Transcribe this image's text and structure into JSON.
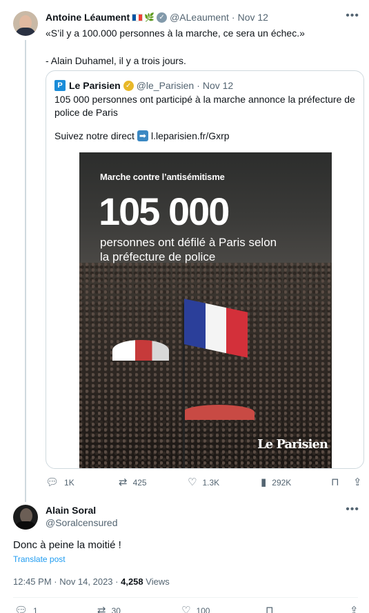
{
  "tweet1": {
    "author": "Antoine Léaument",
    "handle": "@ALeaument",
    "time": "Nov 12",
    "text": "«S’il y a 100.000 personnes à la marche, ce sera un échec.»\n\n- Alain Duhamel, il y a trois jours.",
    "flag_colors": [
      "#0055a4",
      "#ffffff",
      "#ef4135"
    ],
    "sprout_icon": "🌿",
    "quote": {
      "author": "Le Parisien",
      "logo_letter": "P",
      "handle": "@le_Parisien",
      "time": "Nov 12",
      "text": "105 000 personnes ont participé à la marche annonce la préfecture de police de Paris",
      "link_prefix": "Suivez notre direct",
      "link": "l.leparisien.fr/Gxrp",
      "image": {
        "kicker": "Marche contre l’antisémitisme",
        "big_number": "105 000",
        "subtitle": "personnes ont défilé à Paris selon la préfecture de police",
        "brand": "Le Parisien"
      }
    },
    "actions": {
      "reply": "1K",
      "retweet": "425",
      "like": "1.3K",
      "views": "292K"
    }
  },
  "tweet2": {
    "author": "Alain Soral",
    "handle": "@Soralcensured",
    "text": "Donc à peine la moitié !",
    "translate": "Translate post",
    "timestamp": "12:45 PM · Nov 14, 2023",
    "views_count": "4,258",
    "views_label": "Views",
    "actions": {
      "reply": "1",
      "retweet": "30",
      "like": "100"
    }
  },
  "colors": {
    "accent": "#1d9bf0",
    "muted": "#536471",
    "border": "#cfd9de",
    "verified_gold": "#e8b829",
    "verified_gray": "#829aab"
  }
}
